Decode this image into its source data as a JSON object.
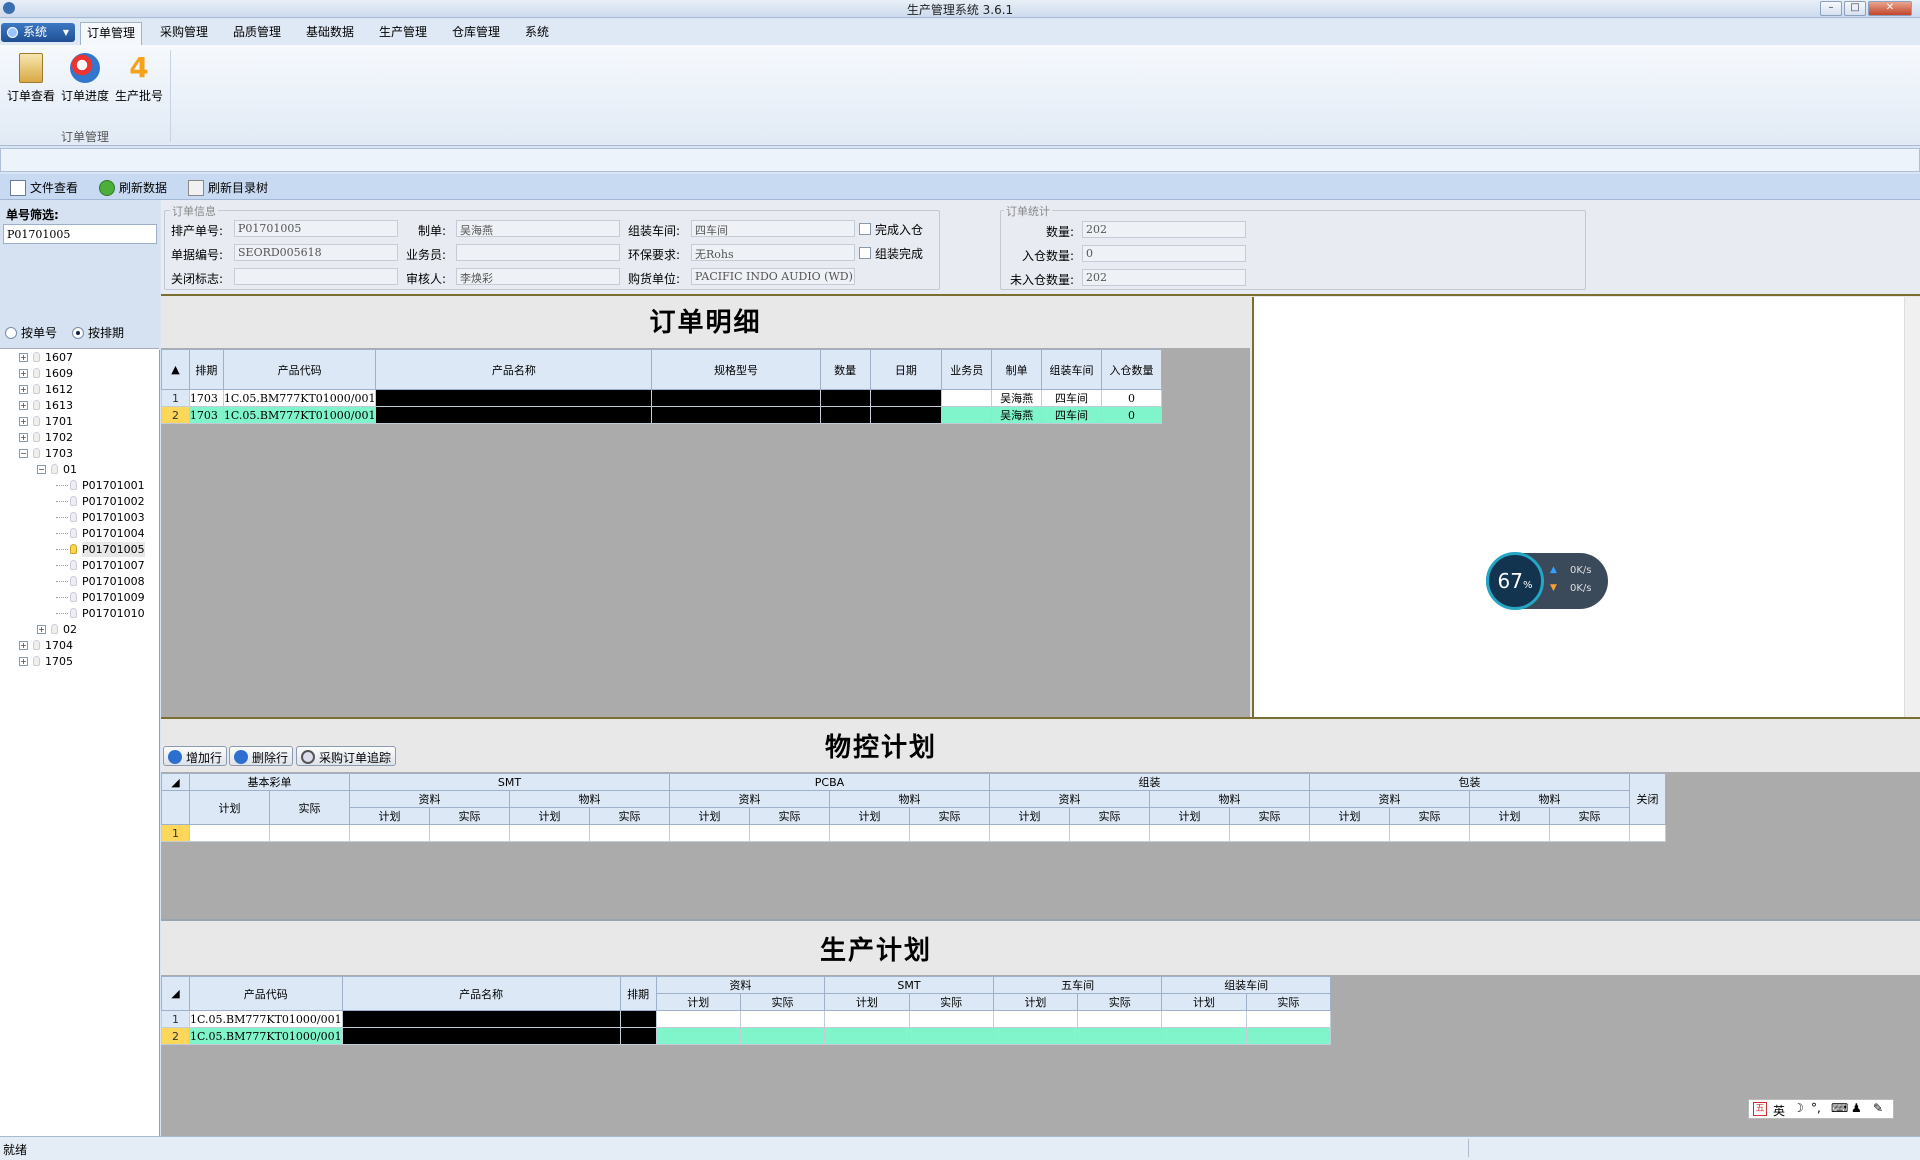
{
  "window": {
    "title": "生产管理系统 3.6.1"
  },
  "menu": {
    "system": "系统",
    "tabs": [
      "订单管理",
      "采购管理",
      "品质管理",
      "基础数据",
      "生产管理",
      "仓库管理",
      "系统"
    ]
  },
  "ribbon": {
    "buttons": [
      "订单查看",
      "订单进度",
      "生产批号"
    ],
    "group": "订单管理"
  },
  "toolbar": {
    "file_view": "文件查看",
    "refresh_data": "刷新数据",
    "refresh_tree": "刷新目录树"
  },
  "left": {
    "filter_label": "单号筛选:",
    "filter_value": "P01701005",
    "radio_order": "按单号",
    "radio_period": "按排期",
    "tree": [
      "1607",
      "1609",
      "1612",
      "1613",
      "1701",
      "1702",
      "1703",
      "01",
      "P01701001",
      "P01701002",
      "P01701003",
      "P01701004",
      "P01701005",
      "P01701007",
      "P01701008",
      "P01701009",
      "P01701010",
      "02",
      "1704",
      "1705"
    ]
  },
  "order_info": {
    "group": "订单信息",
    "l_prod_no": "排产单号:",
    "prod_no": "P01701005",
    "l_doc_no": "单据编号:",
    "doc_no": "SEORD005618",
    "l_close": "关闭标志:",
    "close": "",
    "l_maker": "制单:",
    "maker": "吴海燕",
    "l_sales": "业务员:",
    "sales": "",
    "l_reviewer": "审核人:",
    "reviewer": "李焕彩",
    "l_workshop": "组装车间:",
    "workshop": "四车间",
    "l_env": "环保要求:",
    "env": "无Rohs",
    "l_buyer": "购货单位:",
    "buyer": "PACIFIC INDO AUDIO (WD)",
    "chk_in": "完成入仓",
    "chk_asm": "组装完成"
  },
  "stats": {
    "group": "订单统计",
    "l_qty": "数量:",
    "qty": "202",
    "l_in": "入仓数量:",
    "in": "0",
    "l_notin": "未入仓数量:",
    "notin": "202"
  },
  "detail": {
    "title": "订单明细",
    "headers": [
      "排期",
      "产品代码",
      "产品名称",
      "规格型号",
      "数量",
      "日期",
      "业务员",
      "制单",
      "组装车间",
      "入仓数量"
    ],
    "rows": [
      {
        "n": "1",
        "period": "1703",
        "code": "1C.05.BM777KT01000/001",
        "sales": "",
        "maker": "吴海燕",
        "ws": "四车间",
        "in": "0"
      },
      {
        "n": "2",
        "period": "1703",
        "code": "1C.05.BM777KT01000/001",
        "sales": "",
        "maker": "吴海燕",
        "ws": "四车间",
        "in": "0"
      }
    ]
  },
  "material": {
    "title": "物控计划",
    "btn_add": "增加行",
    "btn_del": "删除行",
    "btn_track": "采购订单追踪",
    "h_basic": "基本彩单",
    "h_smt": "SMT",
    "h_pcba": "PCBA",
    "h_asm": "组装",
    "h_pack": "包装",
    "h_close": "关闭",
    "h_data": "资料",
    "h_mat": "物料",
    "h_plan": "计划",
    "h_actual": "实际",
    "row": "1"
  },
  "production": {
    "title": "生产计划",
    "h_code": "产品代码",
    "h_name": "产品名称",
    "h_period": "排期",
    "h_data": "资料",
    "h_smt": "SMT",
    "h_ws5": "五车间",
    "h_asmws": "组装车间",
    "h_plan": "计划",
    "h_actual": "实际",
    "rows": [
      {
        "n": "1",
        "code": "1C.05.BM777KT01000/001"
      },
      {
        "n": "2",
        "code": "1C.05.BM777KT01000/001"
      }
    ]
  },
  "widget": {
    "percent": "67",
    "unit": "%",
    "up": "0K/s",
    "down": "0K/s"
  },
  "ime": {
    "lang": "英"
  },
  "status": {
    "text": "就绪"
  }
}
